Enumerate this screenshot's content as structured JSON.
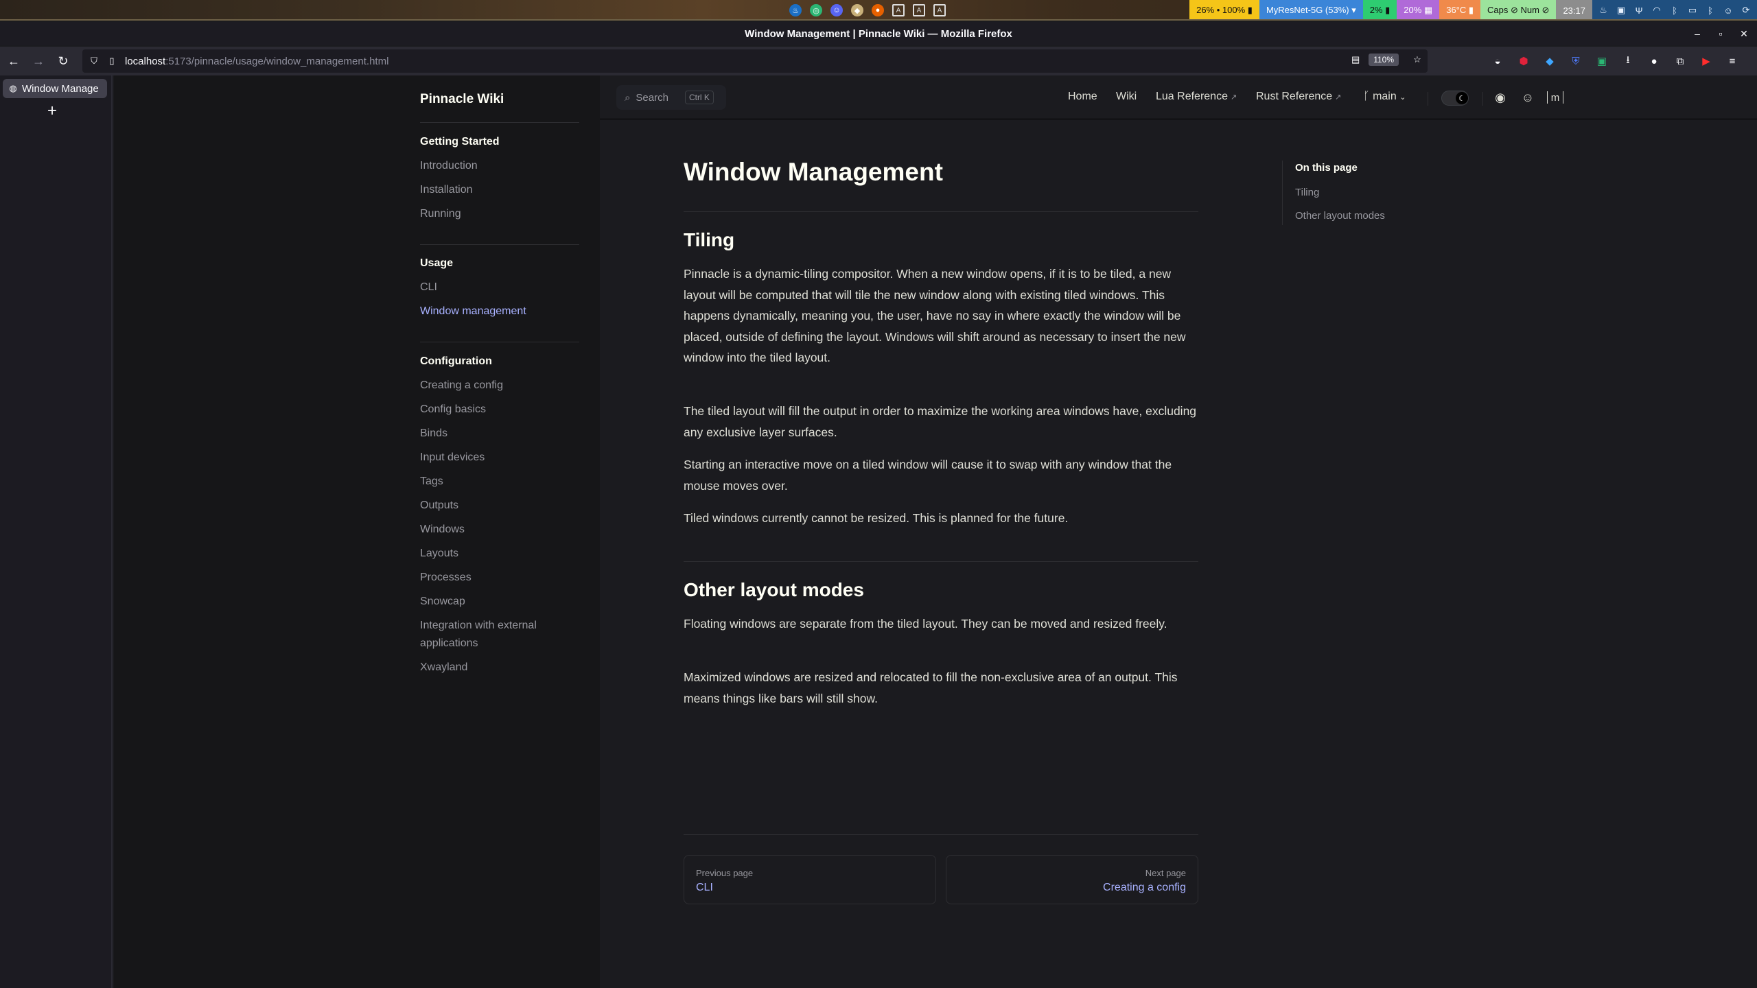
{
  "system_bar": {
    "tray_icons": [
      "steam-icon",
      "green-circle-icon",
      "discord-icon",
      "app-icon",
      "firefox-icon",
      "font-icon-a",
      "font-icon-b",
      "font-icon-c"
    ],
    "modules": [
      {
        "text": "26% • 100% ▮",
        "bg": "#f5c518"
      },
      {
        "text": "MyResNet-5G (53%) ▾",
        "bg": "#3b85d8"
      },
      {
        "text": "2% ▮",
        "bg": "#2ecc71"
      },
      {
        "text": "20% ▦",
        "bg": "#b06ad8"
      },
      {
        "text": "36°C ▮",
        "bg": "#f08a4b"
      },
      {
        "text": "Caps ⊘ Num ⊘",
        "bg": "#9ce39c"
      },
      {
        "text": "23:17",
        "bg": "#8d8d8d"
      }
    ],
    "system_icons": [
      "steam-icon",
      "docker-icon",
      "fork-icon",
      "wifi-icon",
      "bluetooth-icon",
      "card-icon",
      "bluetooth-icon",
      "discord-icon",
      "update-icon"
    ]
  },
  "window": {
    "title": "Window Management | Pinnacle Wiki — Mozilla Firefox"
  },
  "browser": {
    "url_host": "localhost",
    "url_path": ":5173/pinnacle/usage/window_management.html",
    "zoom": "110%",
    "active_tab_label": "Window Manage",
    "new_tab_symbol": "+"
  },
  "site": {
    "title": "Pinnacle Wiki",
    "search_label": "Search",
    "search_shortcut": "Ctrl K",
    "nav": {
      "home": "Home",
      "wiki": "Wiki",
      "lua_reference": "Lua Reference",
      "rust_reference": "Rust Reference",
      "branch": "main",
      "external_arrow": "↗"
    }
  },
  "sidebar": {
    "groups": [
      {
        "title": "Getting Started",
        "items": [
          "Introduction",
          "Installation",
          "Running"
        ]
      },
      {
        "title": "Usage",
        "items": [
          "CLI",
          "Window management"
        ],
        "active_index": 1
      },
      {
        "title": "Configuration",
        "items": [
          "Creating a config",
          "Config basics",
          "Binds",
          "Input devices",
          "Tags",
          "Outputs",
          "Windows",
          "Layouts",
          "Processes",
          "Snowcap",
          "Integration with external applications",
          "Xwayland"
        ]
      }
    ]
  },
  "content": {
    "title": "Window Management",
    "sections": [
      {
        "heading": "Tiling",
        "paragraphs": [
          "Pinnacle is a dynamic-tiling compositor. When a new window opens, if it is to be tiled, a new layout will be computed that will tile the new window along with existing tiled windows. This happens dynamically, meaning you, the user, have no say in where exactly the window will be placed, outside of defining the layout. Windows will shift around as necessary to insert the new window into the tiled layout.",
          "The tiled layout will fill the output in order to maximize the working area windows have, excluding any exclusive layer surfaces.",
          "Starting an interactive move on a tiled window will cause it to swap with any window that the mouse moves over.",
          "Tiled windows currently cannot be resized. This is planned for the future."
        ]
      },
      {
        "heading": "Other layout modes",
        "paragraphs": [
          "Floating windows are separate from the tiled layout. They can be moved and resized freely.",
          "Maximized windows are resized and relocated to fill the non-exclusive area of an output. This means things like bars will still show."
        ]
      }
    ],
    "pager": {
      "prev_desc": "Previous page",
      "prev_title": "CLI",
      "next_desc": "Next page",
      "next_title": "Creating a config"
    }
  },
  "outline": {
    "title": "On this page",
    "items": [
      "Tiling",
      "Other layout modes"
    ]
  },
  "colors": {
    "brand": "#a8b1ff",
    "background": "#1b1b1f",
    "sidebar_bg": "#161618",
    "text": "#dfdfd6",
    "muted": "#98989f"
  }
}
